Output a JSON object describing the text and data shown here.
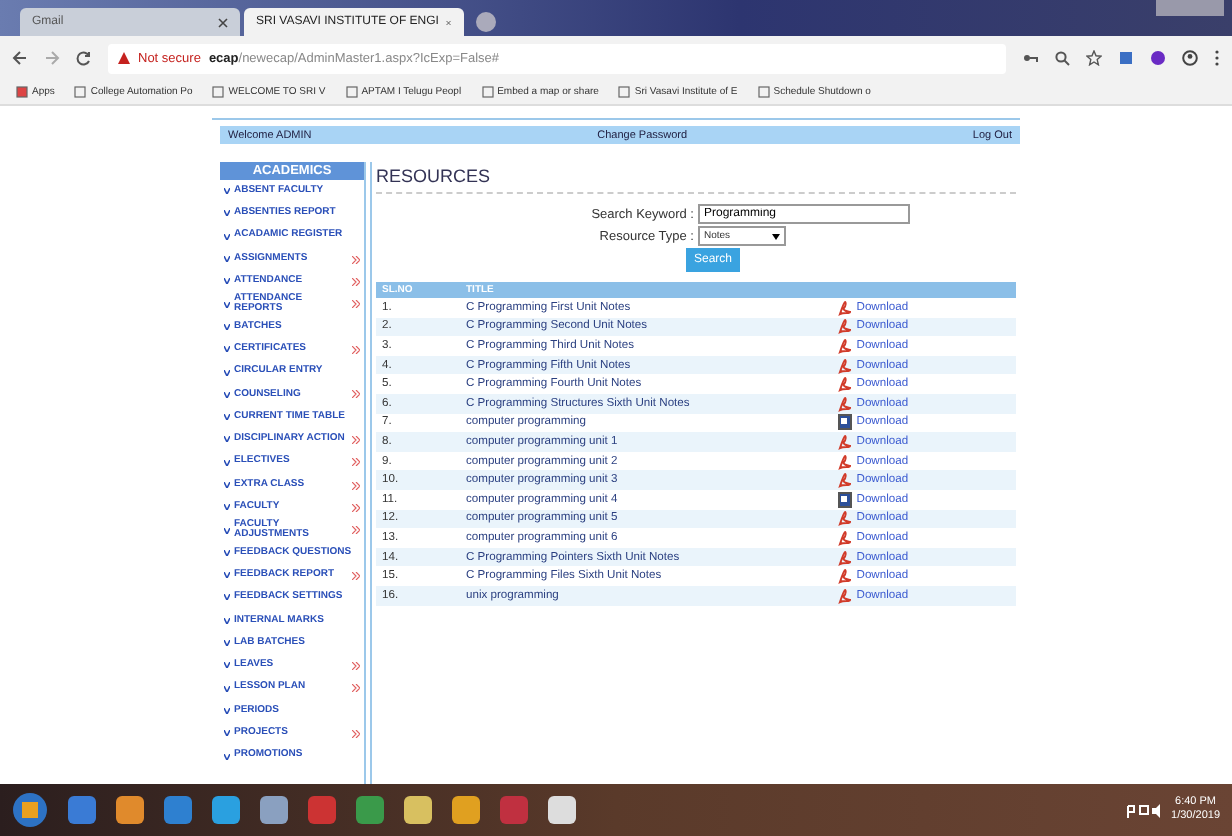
{
  "browser": {
    "tabs": [
      {
        "label": "Gmail",
        "selected": false
      },
      {
        "label": "SRI VASAVI INSTITUTE OF ENGI",
        "selected": true
      }
    ],
    "security": "Not secure",
    "url_host": "ecap",
    "url_path": "/newecap/AdminMaster1.aspx?IcExp=False#",
    "bookmarks": [
      "Apps",
      "College Automation Po",
      "WELCOME TO SRI V",
      "APTAM I Telugu Peopl",
      "Embed a map or share",
      "Sri Vasavi Institute of E",
      "Schedule Shutdown o"
    ]
  },
  "header": {
    "welcome": "Welcome ADMIN",
    "change_password": "Change Password",
    "logout": "Log Out"
  },
  "sidebar": {
    "title": "ACADEMICS",
    "items": [
      {
        "label": "ABSENT FACULTY",
        "has_submenu": false
      },
      {
        "label": "ABSENTIES REPORT",
        "has_submenu": false
      },
      {
        "label": "ACADAMIC REGISTER",
        "has_submenu": false
      },
      {
        "label": "ASSIGNMENTS",
        "has_submenu": true
      },
      {
        "label": "ATTENDANCE",
        "has_submenu": true
      },
      {
        "label": "ATTENDANCE REPORTS",
        "has_submenu": true
      },
      {
        "label": "BATCHES",
        "has_submenu": false
      },
      {
        "label": "CERTIFICATES",
        "has_submenu": true
      },
      {
        "label": "CIRCULAR ENTRY",
        "has_submenu": false
      },
      {
        "label": "COUNSELING",
        "has_submenu": true
      },
      {
        "label": "CURRENT TIME TABLE",
        "has_submenu": false
      },
      {
        "label": "DISCIPLINARY ACTION",
        "has_submenu": true
      },
      {
        "label": "ELECTIVES",
        "has_submenu": true
      },
      {
        "label": "EXTRA CLASS",
        "has_submenu": true
      },
      {
        "label": "FACULTY",
        "has_submenu": true
      },
      {
        "label": "FACULTY ADJUSTMENTS",
        "has_submenu": true
      },
      {
        "label": "FEEDBACK QUESTIONS",
        "has_submenu": false
      },
      {
        "label": "FEEDBACK REPORT",
        "has_submenu": true
      },
      {
        "label": "FEEDBACK SETTINGS",
        "has_submenu": false
      },
      {
        "label": "INTERNAL MARKS",
        "has_submenu": false
      },
      {
        "label": "LAB BATCHES",
        "has_submenu": false
      },
      {
        "label": "LEAVES",
        "has_submenu": true
      },
      {
        "label": "LESSON PLAN",
        "has_submenu": true
      },
      {
        "label": "PERIODS",
        "has_submenu": false
      },
      {
        "label": "PROJECTS",
        "has_submenu": true
      },
      {
        "label": "PROMOTIONS",
        "has_submenu": false
      }
    ]
  },
  "main": {
    "title": "RESOURCES",
    "search_label": "Search Keyword :",
    "search_value": "Programming",
    "type_label": "Resource Type :",
    "type_value": "Notes",
    "search_button": "Search",
    "table": {
      "columns": [
        "SL.NO",
        "TITLE"
      ],
      "rows": [
        {
          "no": "1.",
          "title": "C Programming First Unit Notes",
          "kind": "pdf",
          "link": "Download"
        },
        {
          "no": "2.",
          "title": "C Programming Second Unit Notes",
          "kind": "pdf",
          "link": "Download"
        },
        {
          "no": "3.",
          "title": "C Programming Third Unit Notes",
          "kind": "pdf",
          "link": "Download"
        },
        {
          "no": "4.",
          "title": "C Programming Fifth Unit Notes",
          "kind": "pdf",
          "link": "Download"
        },
        {
          "no": "5.",
          "title": "C Programming Fourth Unit Notes",
          "kind": "pdf",
          "link": "Download"
        },
        {
          "no": "6.",
          "title": "C Programming Structures Sixth Unit Notes",
          "kind": "pdf",
          "link": "Download"
        },
        {
          "no": "7.",
          "title": "computer programming",
          "kind": "word",
          "link": "Download"
        },
        {
          "no": "8.",
          "title": "computer programming unit 1",
          "kind": "pdf",
          "link": "Download"
        },
        {
          "no": "9.",
          "title": "computer programming unit 2",
          "kind": "pdf",
          "link": "Download"
        },
        {
          "no": "10.",
          "title": "computer programming unit 3",
          "kind": "pdf",
          "link": "Download"
        },
        {
          "no": "11.",
          "title": "computer programming unit 4",
          "kind": "word",
          "link": "Download"
        },
        {
          "no": "12.",
          "title": "computer programming unit 5",
          "kind": "pdf",
          "link": "Download"
        },
        {
          "no": "13.",
          "title": "computer programming unit 6",
          "kind": "pdf",
          "link": "Download"
        },
        {
          "no": "14.",
          "title": "C Programming Pointers Sixth Unit Notes",
          "kind": "pdf",
          "link": "Download"
        },
        {
          "no": "15.",
          "title": "C Programming Files Sixth Unit Notes",
          "kind": "pdf",
          "link": "Download"
        },
        {
          "no": "16.",
          "title": "unix programming",
          "kind": "pdf",
          "link": "Download"
        }
      ]
    }
  },
  "taskbar": {
    "time": "6:40 PM",
    "date": "1/30/2019"
  }
}
